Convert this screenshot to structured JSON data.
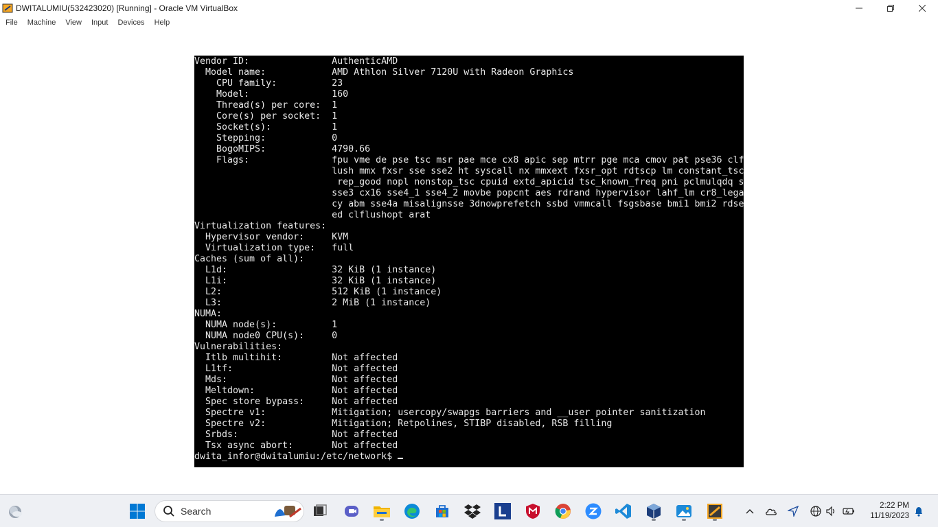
{
  "window": {
    "title": "DWITALUMIU(532423020) [Running] - Oracle VM VirtualBox"
  },
  "menubar": {
    "items": [
      "File",
      "Machine",
      "View",
      "Input",
      "Devices",
      "Help"
    ]
  },
  "terminal": {
    "lines": [
      "Vendor ID:               AuthenticAMD",
      "  Model name:            AMD Athlon Silver 7120U with Radeon Graphics",
      "    CPU family:          23",
      "    Model:               160",
      "    Thread(s) per core:  1",
      "    Core(s) per socket:  1",
      "    Socket(s):           1",
      "    Stepping:            0",
      "    BogoMIPS:            4790.66",
      "    Flags:               fpu vme de pse tsc msr pae mce cx8 apic sep mtrr pge mca cmov pat pse36 clf",
      "                         lush mmx fxsr sse sse2 ht syscall nx mmxext fxsr_opt rdtscp lm constant_tsc",
      "                          rep_good nopl nonstop_tsc cpuid extd_apicid tsc_known_freq pni pclmulqdq s",
      "                         sse3 cx16 sse4_1 sse4_2 movbe popcnt aes rdrand hypervisor lahf_lm cr8_lega",
      "                         cy abm sse4a misalignsse 3dnowprefetch ssbd vmmcall fsgsbase bmi1 bmi2 rdse",
      "                         ed clflushopt arat",
      "Virtualization features:",
      "  Hypervisor vendor:     KVM",
      "  Virtualization type:   full",
      "Caches (sum of all):",
      "  L1d:                   32 KiB (1 instance)",
      "  L1i:                   32 KiB (1 instance)",
      "  L2:                    512 KiB (1 instance)",
      "  L3:                    2 MiB (1 instance)",
      "NUMA:",
      "  NUMA node(s):          1",
      "  NUMA node0 CPU(s):     0",
      "Vulnerabilities:",
      "  Itlb multihit:         Not affected",
      "  L1tf:                  Not affected",
      "  Mds:                   Not affected",
      "  Meltdown:              Not affected",
      "  Spec store bypass:     Not affected",
      "  Spectre v1:            Mitigation; usercopy/swapgs barriers and __user pointer sanitization",
      "  Spectre v2:            Mitigation; Retpolines, STIBP disabled, RSB filling",
      "  Srbds:                 Not affected",
      "  Tsx async abort:       Not affected"
    ],
    "prompt": "dwita_infor@dwitalumiu:/etc/network$ "
  },
  "taskbar": {
    "search_placeholder": "Search",
    "time": "2:22 PM",
    "date": "11/19/2023"
  },
  "colors": {
    "terminal_bg": "#000000",
    "terminal_fg": "#e8e8e8",
    "taskbar_bg": "#eef0f4",
    "win11_blue": "#0078d4"
  },
  "icons": {
    "taskbar": [
      "widgets-icon",
      "start-icon",
      "search-icon",
      "task-view-icon",
      "teams-icon",
      "file-explorer-icon",
      "edge-icon",
      "store-icon",
      "dropbox-icon",
      "l-app-icon",
      "mcafee-icon",
      "chrome-icon",
      "zoom-icon",
      "vscode-icon",
      "virtualbox-icon",
      "photos-icon",
      "clipboard-app-icon"
    ],
    "tray": [
      "chevron-up-icon",
      "onedrive-icon",
      "location-icon",
      "language-icon",
      "volume-icon",
      "battery-icon",
      "notification-bell-icon"
    ]
  }
}
